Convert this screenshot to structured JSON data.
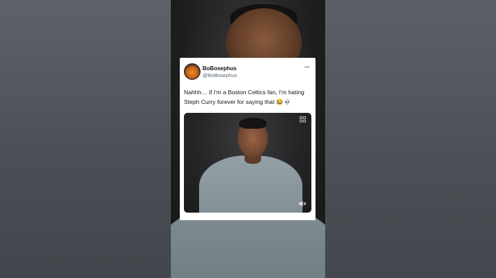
{
  "tweet": {
    "author_name": "BoBosephus",
    "author_handle": "@BoBosephus",
    "text": "Nahhh… if I'm a Boston Celtics fan, I'm hating Steph Curry forever for saying that 😂💀",
    "more_icon": "more-options-icon",
    "media": {
      "type": "video",
      "controls": [
        "grid-icon",
        "volume-muted-icon"
      ]
    }
  },
  "colors": {
    "card_bg": "#ffffff",
    "name": "#0f1419",
    "handle": "#536471",
    "backdrop": "#4b5055"
  }
}
